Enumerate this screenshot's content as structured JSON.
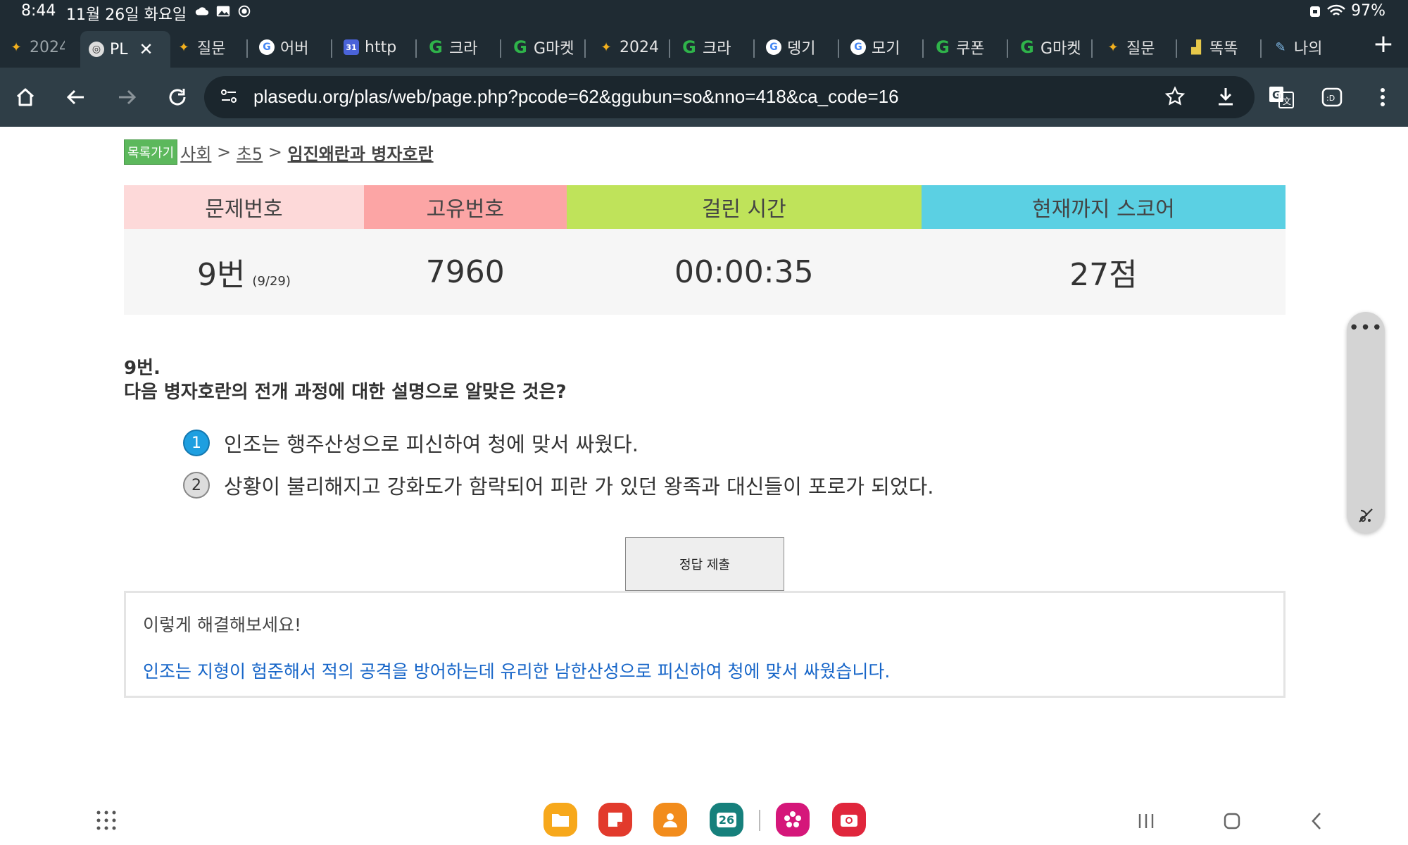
{
  "status_bar": {
    "time": "8:44",
    "date": "11월 26일 화요일",
    "battery": "97%"
  },
  "tabs": [
    {
      "label": "2024",
      "icon": "star-favicon"
    },
    {
      "label": "PL",
      "icon": "globe-favicon",
      "active": true
    },
    {
      "label": "질문",
      "icon": "star-favicon"
    },
    {
      "label": "어버",
      "icon": "google-favicon"
    },
    {
      "label": "http",
      "icon": "calendar-favicon"
    },
    {
      "label": "크라",
      "icon": "green-g-favicon"
    },
    {
      "label": "G마켓",
      "icon": "green-g-favicon"
    },
    {
      "label": "2024",
      "icon": "star-favicon"
    },
    {
      "label": "크라",
      "icon": "green-g-favicon"
    },
    {
      "label": "뎅기",
      "icon": "google-favicon"
    },
    {
      "label": "모기",
      "icon": "google-favicon"
    },
    {
      "label": "쿠폰",
      "icon": "green-g-favicon"
    },
    {
      "label": "G마켓",
      "icon": "green-g-favicon"
    },
    {
      "label": "질문",
      "icon": "star-favicon"
    },
    {
      "label": "똑똑",
      "icon": "chart-favicon"
    },
    {
      "label": "나의",
      "icon": "pen-favicon"
    }
  ],
  "toolbar": {
    "url": "plasedu.org/plas/web/page.php?pcode=62&ggubun=so&nno=418&ca_code=16"
  },
  "breadcrumb": {
    "list_button": "목록가기",
    "subject": "사회",
    "sep1": " > ",
    "grade": "초5",
    "sep2": " > ",
    "unit": "임진왜란과 병자호란"
  },
  "score_table": {
    "headers": {
      "q_number": "문제번호",
      "unique_id": "고유번호",
      "time_taken": "걸린 시간",
      "score": "현재까지 스코어"
    },
    "values": {
      "q_number": "9번",
      "progress": "(9/29)",
      "unique_id": "7960",
      "time_taken": "00:00:35",
      "score": "27점"
    },
    "colors": {
      "q_number": "#fdd9d9",
      "unique_id": "#fca5a5",
      "time_taken": "#bfe35a",
      "score": "#5bd0e3"
    }
  },
  "question": {
    "number": "9번.",
    "text": "다음 병자호란의 전개 과정에 대한 설명으로 알맞은 것은?",
    "options": [
      {
        "num": "1",
        "text": "인조는 행주산성으로 피신하여 청에 맞서 싸웠다.",
        "selected": true
      },
      {
        "num": "2",
        "text": "상황이 불리해지고 강화도가 함락되어 피란 가 있던 왕족과 대신들이 포로가 되었다.",
        "selected": false
      }
    ]
  },
  "submit_button": "정답 제출",
  "hint": {
    "title": "이렇게 해결해보세요!",
    "text": "인조는 지형이 험준해서 적의 공격을 방어하는데 유리한 남한산성으로 피신하여 청에 맞서 싸웠습니다."
  },
  "dock": {
    "calendar_day": "26"
  }
}
